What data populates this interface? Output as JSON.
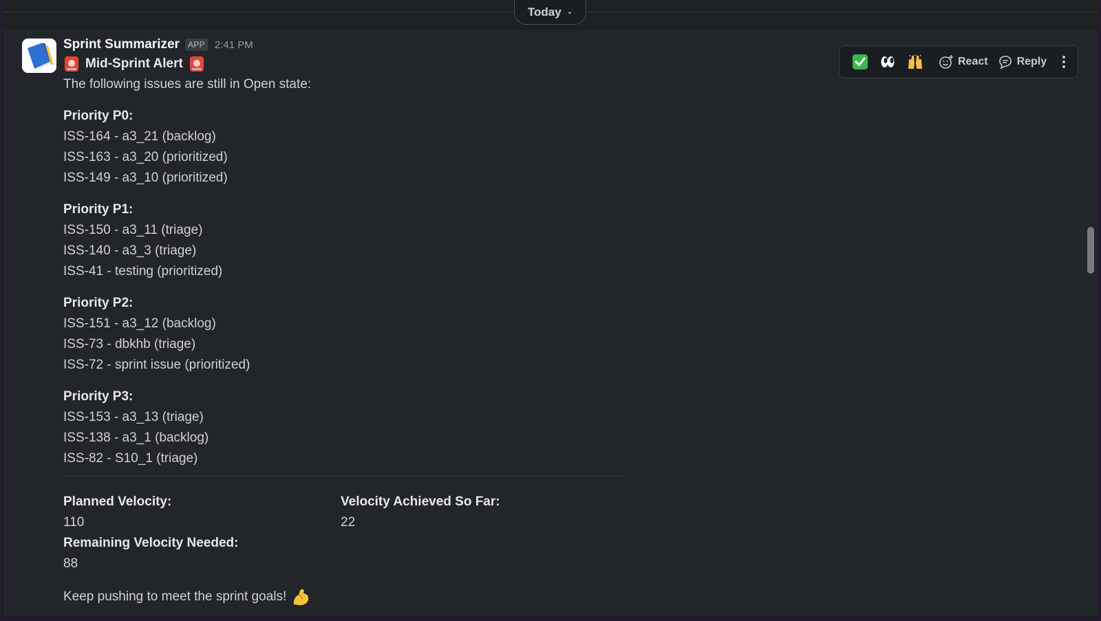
{
  "date_divider": {
    "label": "Today"
  },
  "message": {
    "sender": "Sprint Summarizer",
    "badge": "APP",
    "time": "2:41 PM",
    "alert_title": "Mid-Sprint Alert",
    "intro": "The following issues are still in Open state:",
    "groups": [
      {
        "heading": "Priority P0:",
        "items": [
          "ISS-164 - a3_21 (backlog)",
          "ISS-163 - a3_20 (prioritized)",
          "ISS-149 - a3_10 (prioritized)"
        ]
      },
      {
        "heading": "Priority P1:",
        "items": [
          "ISS-150 - a3_11 (triage)",
          "ISS-140 - a3_3 (triage)",
          "ISS-41 - testing (prioritized)"
        ]
      },
      {
        "heading": "Priority P2:",
        "items": [
          "ISS-151 - a3_12 (backlog)",
          "ISS-73 - dbkhb (triage)",
          "ISS-72 - sprint issue (prioritized)"
        ]
      },
      {
        "heading": "Priority P3:",
        "items": [
          "ISS-153 - a3_13 (triage)",
          "ISS-138 - a3_1 (backlog)",
          "ISS-82 - S10_1 (triage)"
        ]
      }
    ],
    "fields": {
      "planned_label": "Planned Velocity:",
      "planned_value": "110",
      "achieved_label": "Velocity Achieved So Far:",
      "achieved_value": "22",
      "remaining_label": "Remaining Velocity Needed:",
      "remaining_value": "88"
    },
    "closing": "Keep pushing to meet the sprint goals!"
  },
  "hover_actions": {
    "emojis": [
      "check-mark-emoji",
      "eyes-emoji",
      "raised-hands-emoji"
    ],
    "react_label": "React",
    "reply_label": "Reply"
  },
  "colors": {
    "background": "#1a1d21",
    "message_hover": "#222529",
    "text": "#d1d2d3",
    "badge_bg": "#3a3d42"
  }
}
